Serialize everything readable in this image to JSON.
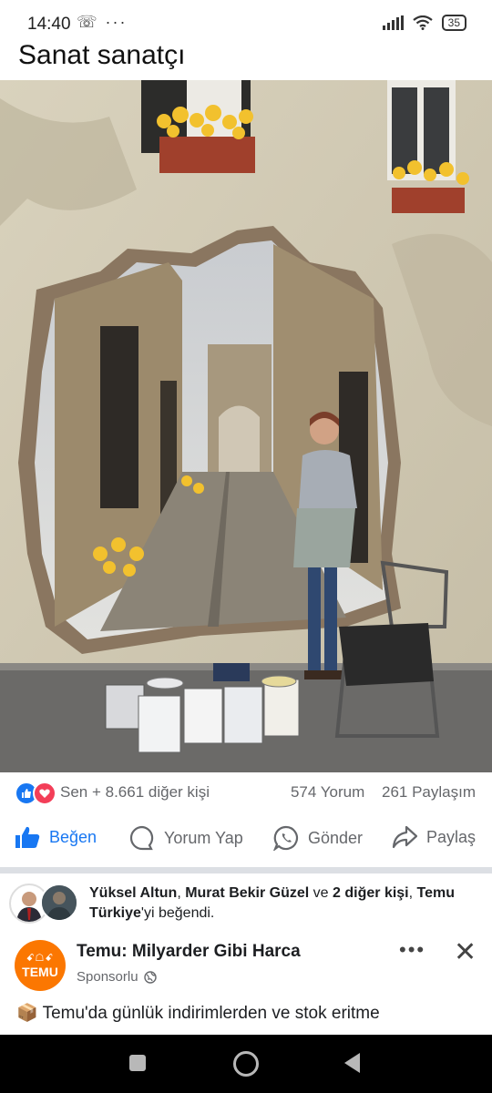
{
  "status_bar": {
    "time": "14:40",
    "left_icons": [
      "missed-call-icon",
      "more-dots-icon"
    ],
    "battery": "35"
  },
  "post": {
    "title": "Sanat sanatçı",
    "image_description_icon": "street-mural-photo"
  },
  "reactions": {
    "icons": [
      "like-reaction-icon",
      "love-reaction-icon"
    ],
    "summary": "Sen + 8.661 diğer kişi",
    "comments": "574 Yorum",
    "shares": "261 Paylaşım"
  },
  "actions": {
    "like": "Beğen",
    "comment": "Yorum Yap",
    "send": "Gönder",
    "share": "Paylaş"
  },
  "liked_by": {
    "name1": "Yüksel Altun",
    "sep1": ", ",
    "name2": "Murat Bekir Güzel",
    "sep2": " ve ",
    "others": "2 diğer kişi",
    "sep3": ", ",
    "page": "Temu Türkiye",
    "suffix": "'yi beğendi."
  },
  "sponsored": {
    "logo_top": "ꗃ☖ꗃ",
    "logo_text": "TEMU",
    "title": "Temu: Milyarder Gibi Harca",
    "label": "Sponsorlu",
    "body": "📦 Temu'da günlük indirimlerden ve stok eritme"
  },
  "colors": {
    "facebook_blue": "#1877f2",
    "temu_orange": "#fb7701",
    "secondary_text": "#65676b"
  }
}
